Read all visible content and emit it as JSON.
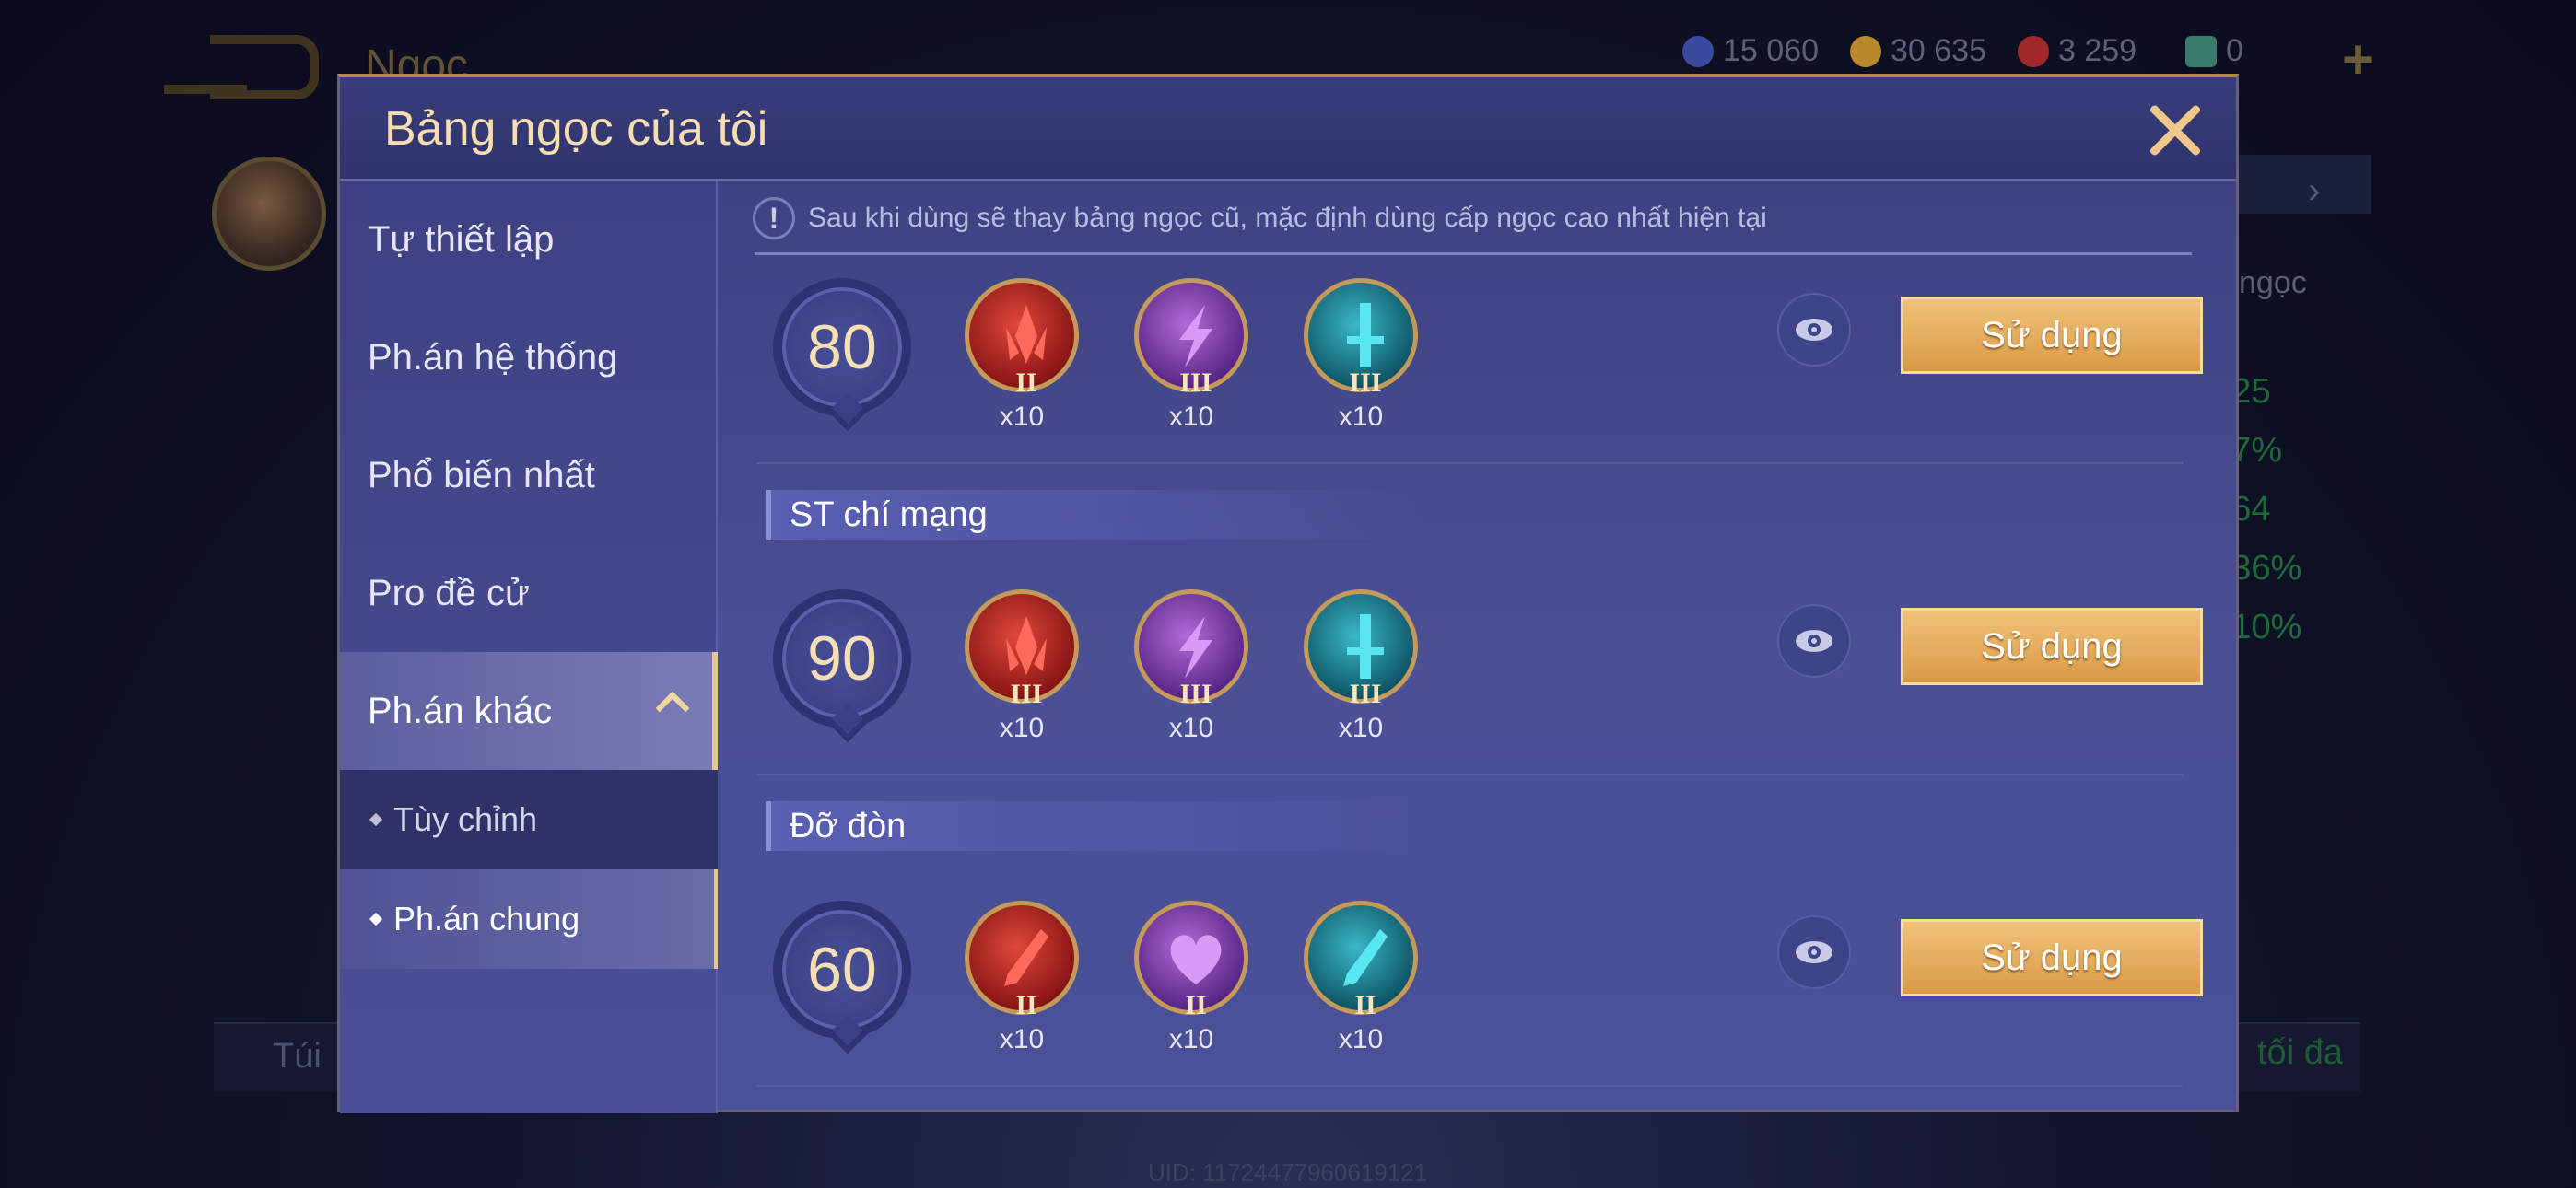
{
  "background": {
    "title": "Ngọc",
    "currencies": [
      {
        "icon": "blue-gem-icon",
        "value": "15 060",
        "color": "#3a4aa0"
      },
      {
        "icon": "gold-coin-icon",
        "value": "30 635",
        "color": "#b8892a"
      },
      {
        "icon": "red-gem-icon",
        "value": "3 259",
        "color": "#a0282a"
      },
      {
        "icon": "voucher-icon",
        "value": "0",
        "color": "#3a7a6a"
      }
    ],
    "right_label": "ngọc",
    "stats": [
      "+25",
      "+7%",
      "+64",
      "+36%",
      "+10%"
    ],
    "bottom_left": "Túi",
    "bottom_right": "tối đa",
    "uid": "UID: 11724477960619121"
  },
  "dialog": {
    "title": "Bảng ngọc của tôi",
    "sidebar": {
      "items": [
        "Tự thiết lập",
        "Ph.án hệ thống",
        "Phổ biến nhất",
        "Pro đề cử",
        "Ph.án khác"
      ],
      "subitems": [
        "Tùy chỉnh",
        "Ph.án chung"
      ]
    },
    "notice": "Sau khi dùng sẽ thay bảng ngọc cũ, mặc định dùng cấp ngọc cao nhất hiện tại",
    "use_label": "Sử dụng",
    "setups": [
      {
        "label": "",
        "level": "80",
        "gems": [
          {
            "color": "red",
            "icon": "red-spike-gem-icon",
            "tier": "II",
            "qty": "x10"
          },
          {
            "color": "purple",
            "icon": "purple-lightning-gem-icon",
            "tier": "III",
            "qty": "x10"
          },
          {
            "color": "cyan",
            "icon": "cyan-sword-gem-icon",
            "tier": "III",
            "qty": "x10"
          }
        ]
      },
      {
        "label": "ST chí mạng",
        "level": "90",
        "gems": [
          {
            "color": "red",
            "icon": "red-spike-gem-icon",
            "tier": "III",
            "qty": "x10"
          },
          {
            "color": "purple",
            "icon": "purple-lightning-gem-icon",
            "tier": "III",
            "qty": "x10"
          },
          {
            "color": "cyan",
            "icon": "cyan-sword-gem-icon",
            "tier": "III",
            "qty": "x10"
          }
        ]
      },
      {
        "label": "Đỡ đòn",
        "level": "60",
        "gems": [
          {
            "color": "red",
            "icon": "red-blade-gem-icon",
            "tier": "II",
            "qty": "x10"
          },
          {
            "color": "purple",
            "icon": "purple-heart-gem-icon",
            "tier": "II",
            "qty": "x10"
          },
          {
            "color": "cyan",
            "icon": "cyan-blade-gem-icon",
            "tier": "II",
            "qty": "x10"
          }
        ]
      }
    ]
  }
}
